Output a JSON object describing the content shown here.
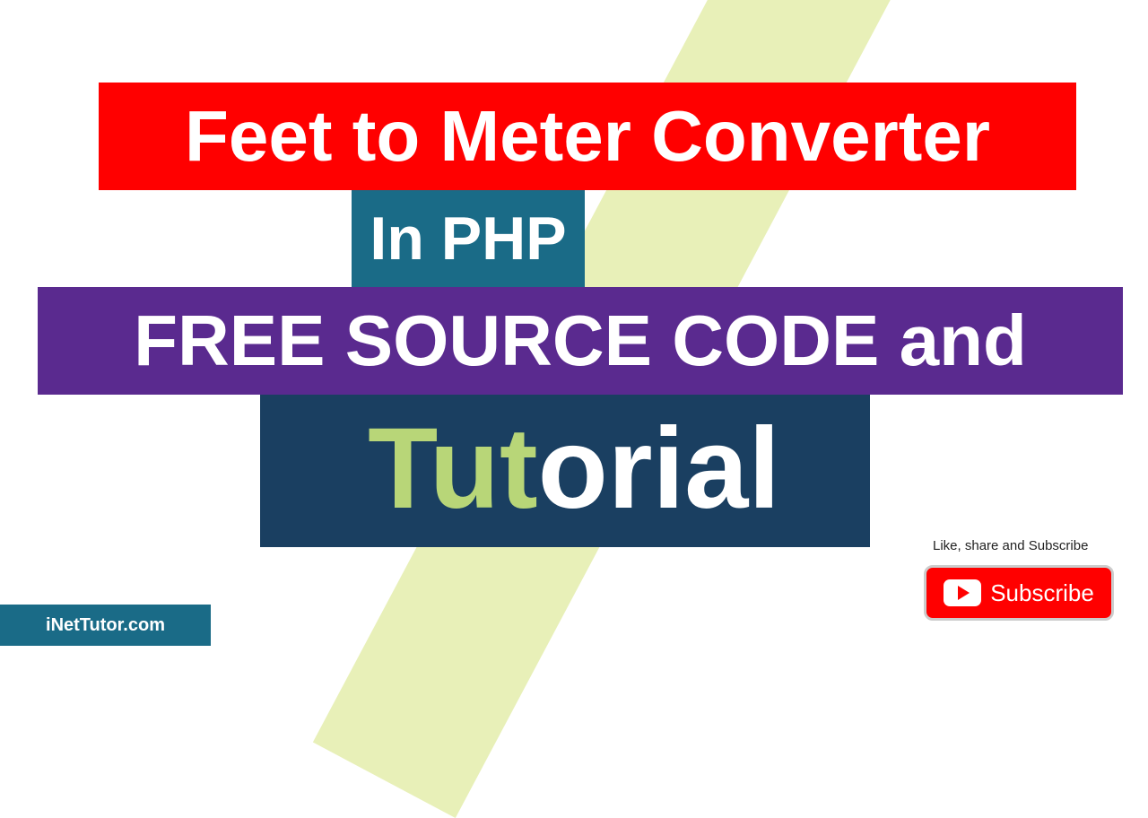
{
  "main_banner": "Feet to Meter Converter",
  "language_box": "In PHP",
  "source_banner": "FREE SOURCE CODE and",
  "tutorial_front": "Tut",
  "tutorial_back": "orial",
  "cta_text": "Like, share and Subscribe",
  "subscribe_label": "Subscribe",
  "site_name": "iNetTutor.com"
}
